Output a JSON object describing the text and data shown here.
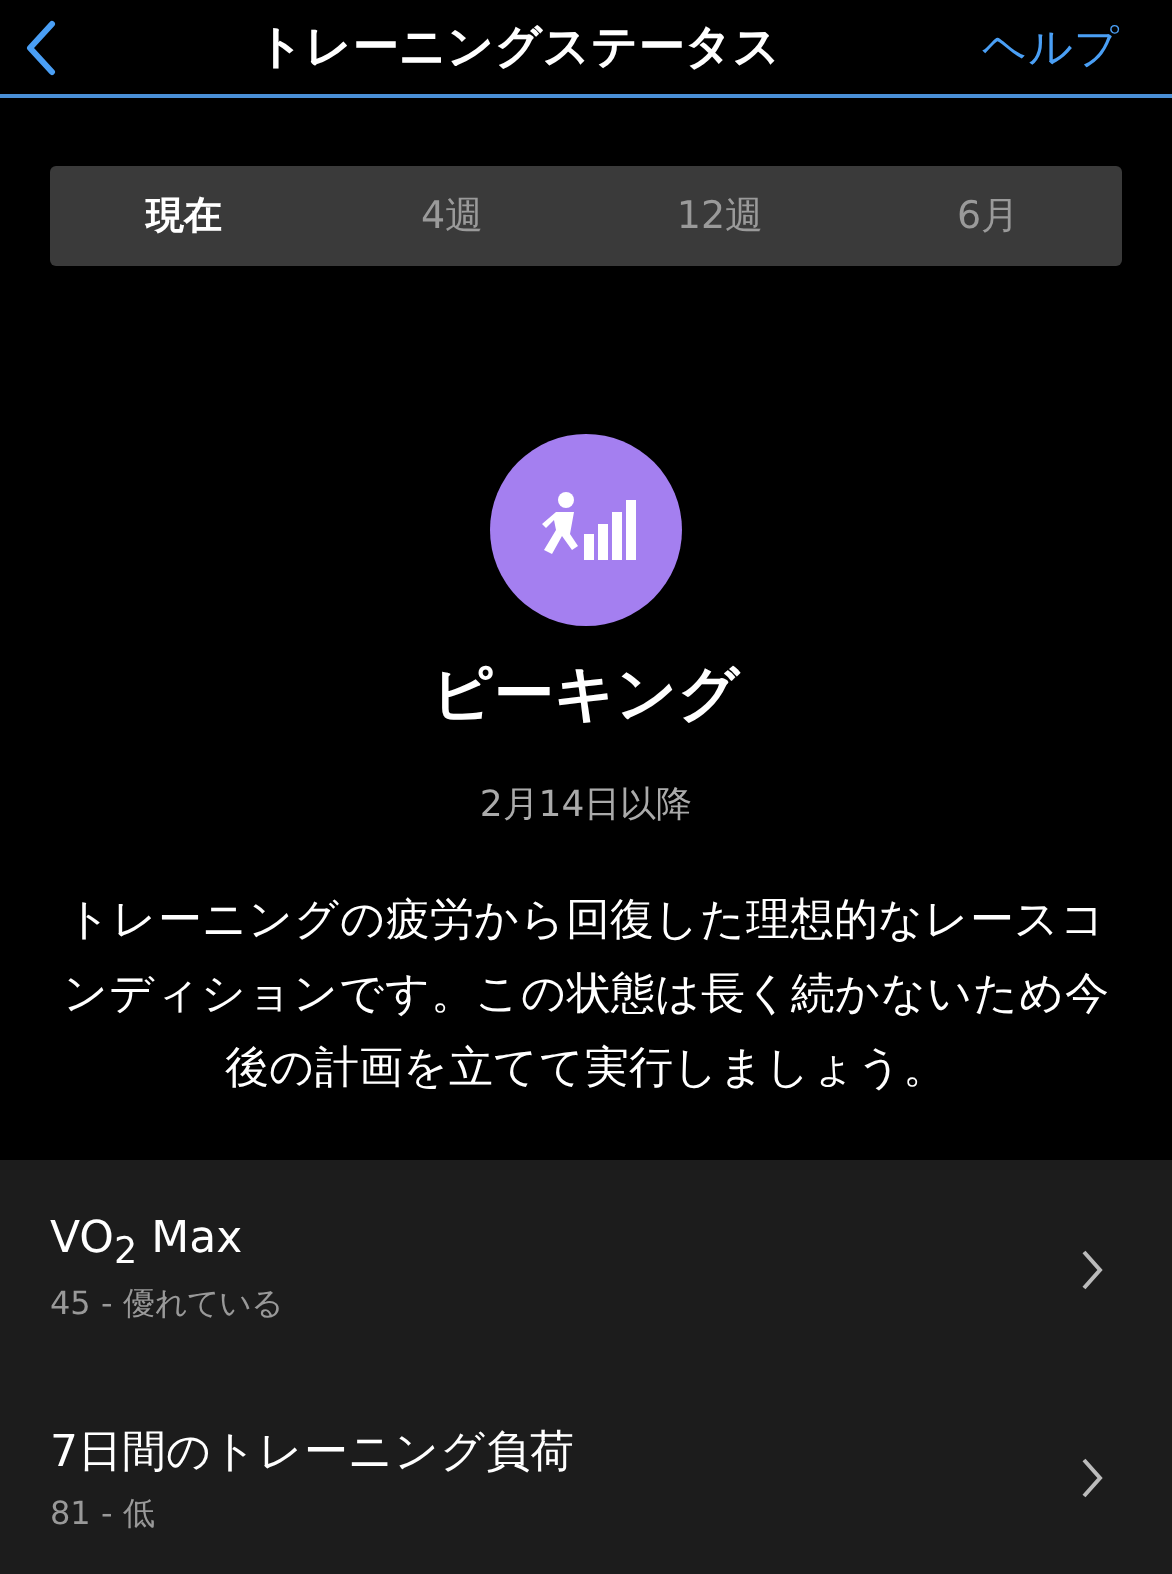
{
  "header": {
    "title": "トレーニングステータス",
    "help": "ヘルプ"
  },
  "tabs": [
    {
      "label": "現在",
      "selected": true
    },
    {
      "label": "4週",
      "selected": false
    },
    {
      "label": "12週",
      "selected": false
    },
    {
      "label": "6月",
      "selected": false
    }
  ],
  "status": {
    "title": "ピーキング",
    "since": "2月14日以降",
    "description": "トレーニングの疲労から回復した理想的なレースコンディションです。この状態は長く続かないため今後の計画を立てて実行しましょう。",
    "color": "#a47ff0"
  },
  "items": [
    {
      "title": "VO$_{2}$ Max",
      "value": "45 - 優れている"
    },
    {
      "title": "7日間のトレーニング負荷",
      "value": "81 - 低"
    }
  ]
}
